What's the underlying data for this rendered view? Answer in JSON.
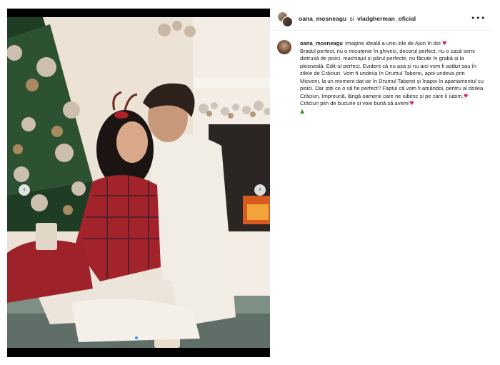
{
  "header": {
    "user1": "oana_mosneagu",
    "separator": "și",
    "user2": "vladgherman_oficial",
    "more_icon": "ellipsis-icon"
  },
  "carousel": {
    "prev_icon": "chevron-left-icon",
    "next_icon": "chevron-right-icon",
    "prev_glyph": "‹",
    "next_glyph": "›",
    "slide_count": 4,
    "active_slide": 2
  },
  "caption": {
    "username": "oana_mosneagu",
    "line1": "Imagine ideală a unei zile de Ajun în doi ",
    "line2": "Bradul perfect, nu o micuțenie în ghiveci, decorul perfect, nu o casă semi distrusă de pisici, machiajul și părul perfecte, nu făcute în grabă și la plesneală. Edit-ul perfect. Evident că nu așa și nu aici vom fi astăzi sau în zilele de Crăciun. Vom fi undeva în Drumul Taberei, apoi undeva prin Mioveni, la un moment dat iar în Drumul Taberei și înapoi în apartamentul cu pisici. Dar știți ce o să fie perfect? Faptul că vom fi amândoi, pentru al doilea Crăciun, împreună, lângă oamenii care ne iubesc și pe care îi iubim.",
    "line3": "Crăciun plin de bucurie și voie bună să avem!",
    "heart_glyph": "♥",
    "tree_glyph": "▲"
  },
  "colors": {
    "heart": "#e0245e",
    "active_dot": "#3897f0"
  }
}
